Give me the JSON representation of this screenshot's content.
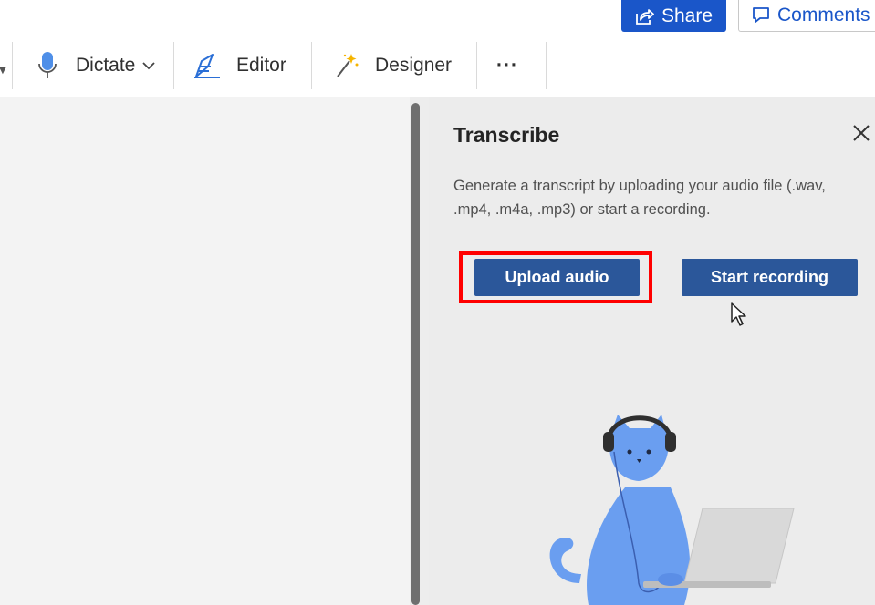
{
  "topbar": {
    "share_label": "Share",
    "comments_label": "Comments"
  },
  "ribbon": {
    "dictate_label": "Dictate",
    "editor_label": "Editor",
    "designer_label": "Designer",
    "more_label": "···"
  },
  "panel": {
    "title": "Transcribe",
    "description_line1": "Generate a transcript by uploading your audio file (.wav,",
    "description_line2": ".mp4, .m4a, .mp3) or start a recording.",
    "upload_label": "Upload audio",
    "record_label": "Start recording"
  },
  "colors": {
    "share_blue": "#1a56c9",
    "button_blue": "#2b579a",
    "highlight_red": "#ff0000",
    "cat_blue": "#6a9ef0"
  },
  "icons": [
    "share-icon",
    "comment-icon",
    "microphone-icon",
    "chevron-down-icon",
    "editor-pen-icon",
    "designer-wand-icon",
    "more-icon",
    "close-icon",
    "mouse-cursor-icon"
  ]
}
